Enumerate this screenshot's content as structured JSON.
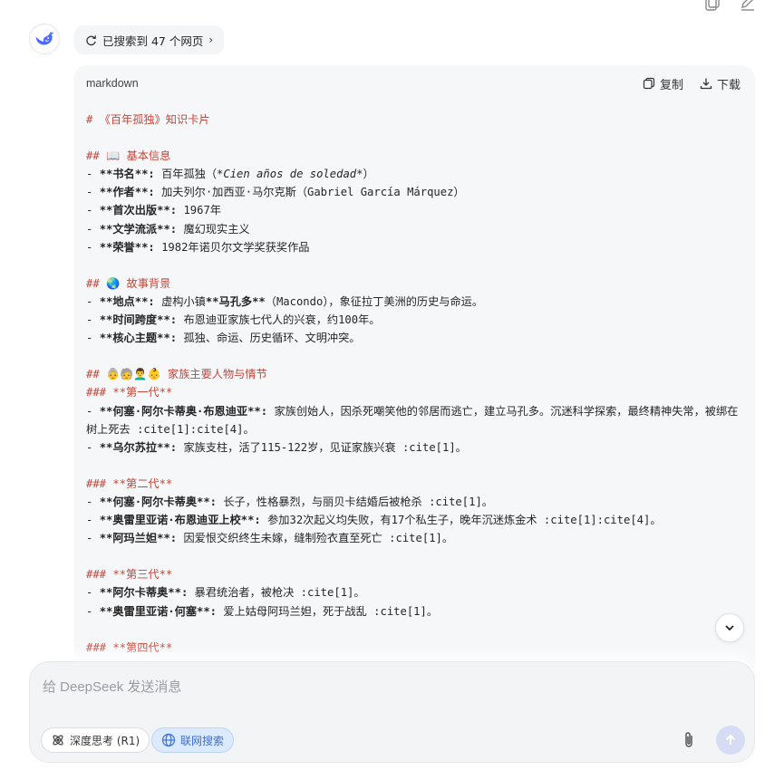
{
  "search": {
    "label": "已搜索到 47 个网页",
    "chevron": "›"
  },
  "code": {
    "lang": "markdown",
    "copy_label": "复制",
    "download_label": "下载"
  },
  "lines": [
    {
      "segs": [
        {
          "t": "# 《百年孤独》知识卡片",
          "c": "h"
        }
      ]
    },
    {
      "segs": []
    },
    {
      "segs": [
        {
          "t": "## 📖 基本信息",
          "c": "h"
        }
      ]
    },
    {
      "segs": [
        {
          "t": "- "
        },
        {
          "t": "**书名**:",
          "c": "b"
        },
        {
          "t": " 百年孤独（"
        },
        {
          "t": "*Cien años de soledad*",
          "c": "i"
        },
        {
          "t": "）"
        }
      ]
    },
    {
      "segs": [
        {
          "t": "- "
        },
        {
          "t": "**作者**:",
          "c": "b"
        },
        {
          "t": " 加夫列尔·加西亚·马尔克斯（Gabriel García Márquez）"
        }
      ]
    },
    {
      "segs": [
        {
          "t": "- "
        },
        {
          "t": "**首次出版**:",
          "c": "b"
        },
        {
          "t": " 1967年"
        }
      ]
    },
    {
      "segs": [
        {
          "t": "- "
        },
        {
          "t": "**文学流派**:",
          "c": "b"
        },
        {
          "t": " 魔幻现实主义"
        }
      ]
    },
    {
      "segs": [
        {
          "t": "- "
        },
        {
          "t": "**荣誉**:",
          "c": "b"
        },
        {
          "t": " 1982年诺贝尔文学奖获奖作品"
        }
      ]
    },
    {
      "segs": []
    },
    {
      "segs": [
        {
          "t": "## 🌏 故事背景",
          "c": "h"
        }
      ]
    },
    {
      "segs": [
        {
          "t": "- "
        },
        {
          "t": "**地点**:",
          "c": "b"
        },
        {
          "t": " 虚构小镇"
        },
        {
          "t": "**马孔多**",
          "c": "b"
        },
        {
          "t": "（Macondo），象征拉丁美洲的历史与命运。"
        }
      ]
    },
    {
      "segs": [
        {
          "t": "- "
        },
        {
          "t": "**时间跨度**:",
          "c": "b"
        },
        {
          "t": " 布恩迪亚家族七代人的兴衰，约100年。"
        }
      ]
    },
    {
      "segs": [
        {
          "t": "- "
        },
        {
          "t": "**核心主题**:",
          "c": "b"
        },
        {
          "t": " 孤独、命运、历史循环、文明冲突。"
        }
      ]
    },
    {
      "segs": []
    },
    {
      "segs": [
        {
          "t": "## 👵🧓👨‍🦱👶 家族主要人物与情节",
          "c": "h"
        }
      ]
    },
    {
      "segs": [
        {
          "t": "### **第一代**",
          "c": "h"
        }
      ]
    },
    {
      "segs": [
        {
          "t": "- "
        },
        {
          "t": "**何塞·阿尔卡蒂奥·布恩迪亚**:",
          "c": "b"
        },
        {
          "t": " 家族创始人，因杀死嘲笑他的邻居而逃亡，建立马孔多。沉迷科学探索，最终精神失常，被绑在树上死去 :cite[1]:cite[4]。"
        }
      ]
    },
    {
      "segs": [
        {
          "t": "- "
        },
        {
          "t": "**乌尔苏拉**:",
          "c": "b"
        },
        {
          "t": " 家族支柱，活了115-122岁，见证家族兴衰 :cite[1]。"
        }
      ]
    },
    {
      "segs": []
    },
    {
      "segs": [
        {
          "t": "### **第二代**",
          "c": "h"
        }
      ]
    },
    {
      "segs": [
        {
          "t": "- "
        },
        {
          "t": "**何塞·阿尔卡蒂奥**:",
          "c": "b"
        },
        {
          "t": " 长子，性格暴烈，与丽贝卡结婚后被枪杀 :cite[1]。"
        }
      ]
    },
    {
      "segs": [
        {
          "t": "- "
        },
        {
          "t": "**奥雷里亚诺·布恩迪亚上校**:",
          "c": "b"
        },
        {
          "t": " 参加32次起义均失败，有17个私生子，晚年沉迷炼金术 :cite[1]:cite[4]。"
        }
      ]
    },
    {
      "segs": [
        {
          "t": "- "
        },
        {
          "t": "**阿玛兰妲**:",
          "c": "b"
        },
        {
          "t": " 因爱恨交织终生未嫁，缝制殓衣直至死亡 :cite[1]。"
        }
      ]
    },
    {
      "segs": []
    },
    {
      "segs": [
        {
          "t": "### **第三代**",
          "c": "h"
        }
      ]
    },
    {
      "segs": [
        {
          "t": "- "
        },
        {
          "t": "**阿尔卡蒂奥**:",
          "c": "b"
        },
        {
          "t": " 暴君统治者，被枪决 :cite[1]。"
        }
      ]
    },
    {
      "segs": [
        {
          "t": "- "
        },
        {
          "t": "**奥雷里亚诺·何塞**:",
          "c": "b"
        },
        {
          "t": " 爱上姑母阿玛兰妲，死于战乱 :cite[1]。"
        }
      ]
    },
    {
      "segs": []
    },
    {
      "segs": [
        {
          "t": "### **第四代**",
          "c": "h"
        }
      ]
    }
  ],
  "input": {
    "placeholder": "给 DeepSeek 发送消息",
    "value": ""
  },
  "chips": {
    "think_label": "深度思考 (R1)",
    "search_label": "联网搜索"
  },
  "colors": {
    "heading": "#c4473a",
    "accent_blue": "#3b6fd8",
    "send_bg": "#d6dcf4"
  }
}
